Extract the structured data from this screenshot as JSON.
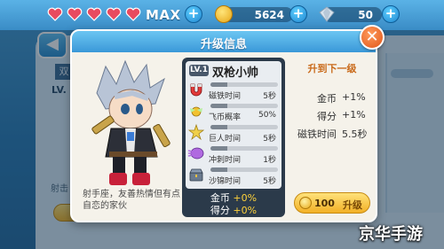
{
  "status_bar": {
    "max_label": "MAX",
    "coins": "5624",
    "gems": "50",
    "heart_count": 5,
    "heart_color": "#e84a5f",
    "accent": "#3a98d8"
  },
  "background": {
    "back_label": "◀",
    "tab_label": "双",
    "level_label": "LV.",
    "side_text": "射击"
  },
  "modal": {
    "title": "升级信息",
    "close_label": "✕",
    "hero": {
      "level": "LV.1",
      "name": "双枪小帅",
      "description": "射手座，友善热情但有点自恋的家伙"
    },
    "stats": [
      {
        "icon": "magnet-icon",
        "label": "磁铁时间",
        "value": "5秒",
        "fill": 0.25
      },
      {
        "icon": "wing-icon",
        "label": "飞币概率",
        "value": "50%",
        "fill": 0.25
      },
      {
        "icon": "giant-icon",
        "label": "巨人时间",
        "value": "5秒",
        "fill": 0.25
      },
      {
        "icon": "dash-icon",
        "label": "冲刺时间",
        "value": "1秒",
        "fill": 0.25
      },
      {
        "icon": "treasure-icon",
        "label": "沙锦时间",
        "value": "5秒",
        "fill": 0.25
      }
    ],
    "bonus": [
      {
        "label": "金币",
        "value": "+0%"
      },
      {
        "label": "得分",
        "value": "+0%"
      }
    ],
    "next_level": {
      "title": "升到下一级",
      "rows": [
        {
          "label": "金币",
          "value": "+1%"
        },
        {
          "label": "得分",
          "value": "+1%"
        },
        {
          "label": "磁铁时间",
          "value": "5.5秒"
        }
      ],
      "upgrade_cost": "100",
      "upgrade_label": "升级"
    }
  },
  "watermark": "京华手游"
}
